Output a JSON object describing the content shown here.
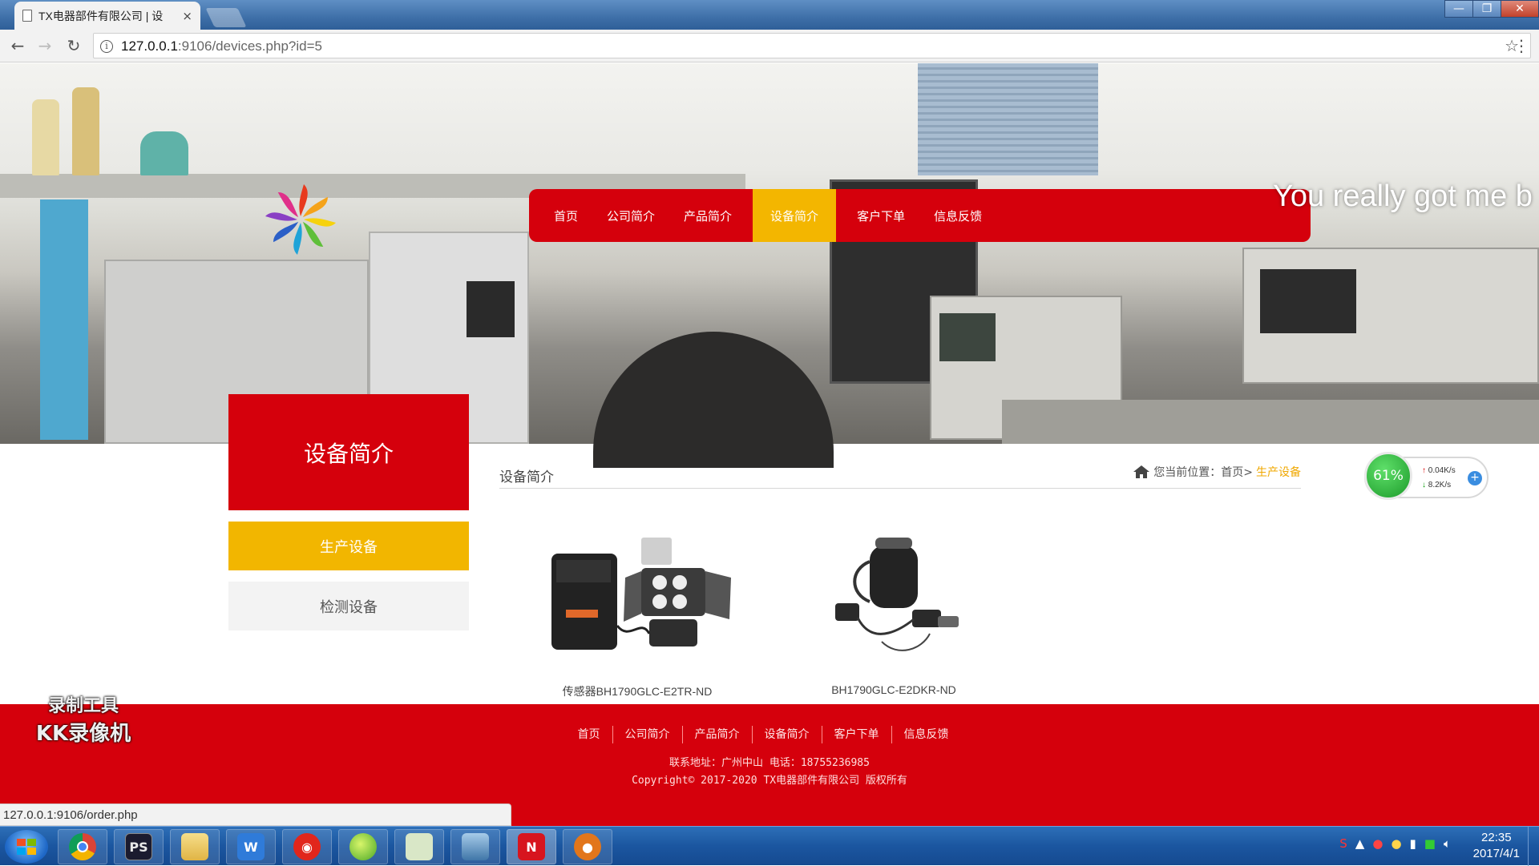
{
  "browser": {
    "tab_title": "TX电器部件有限公司 | 设",
    "tab_close": "×",
    "url_host": "127.0.0.1",
    "url_rest": ":9106/devices.php?id=5",
    "back": "←",
    "forward": "→",
    "reload": "↻",
    "star": "☆",
    "menu": "⋮",
    "win_min": "—",
    "win_max": "❐",
    "win_close": "✕",
    "status_url": "127.0.0.1:9106/order.php"
  },
  "header": {
    "nav": [
      {
        "label": "首页"
      },
      {
        "label": "公司简介"
      },
      {
        "label": "产品简介"
      },
      {
        "label": "设备简介",
        "active": true
      },
      {
        "label": "客户下单"
      },
      {
        "label": "信息反馈"
      }
    ],
    "marquee": "You really got me b"
  },
  "speed_widget": {
    "percent": "61%",
    "up": "0.04K/s",
    "down": "8.2K/s",
    "plus": "+"
  },
  "sidebar": {
    "title": "设备简介",
    "items": [
      {
        "label": "生产设备",
        "active": true
      },
      {
        "label": "检测设备",
        "active": false
      }
    ]
  },
  "content": {
    "title": "设备简介",
    "breadcrumb": {
      "prefix": "您当前位置：首页>",
      "current": "生产设备"
    },
    "products": [
      {
        "caption": "传感器BH1790GLC-E2TR-ND"
      },
      {
        "caption": "BH1790GLC-E2DKR-ND"
      }
    ]
  },
  "footer": {
    "nav": [
      "首页",
      "公司简介",
      "产品简介",
      "设备简介",
      "客户下单",
      "信息反馈"
    ],
    "address": "联系地址：广州中山 电话：18755236985",
    "copyright": "Copyright© 2017-2020 TX电器部件有限公司 版权所有"
  },
  "watermark": {
    "line1": "录制工具",
    "line2": "KK录像机"
  },
  "taskbar": {
    "apps": [
      "chrome-icon",
      "photoshop-icon",
      "explorer-icon",
      "wps-icon",
      "netease-music-icon",
      "browser-ball-icon",
      "notepad-icon",
      "image-viewer-icon",
      "app-red-icon",
      "kk-recorder-icon"
    ],
    "ps_label": "PS",
    "time": "22:35",
    "date": "2017/4/1"
  }
}
